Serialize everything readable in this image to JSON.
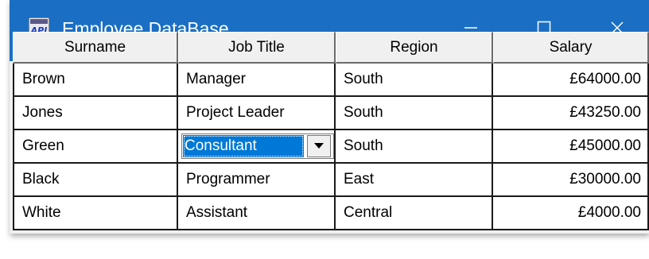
{
  "window": {
    "title": "Employee DataBase",
    "icon": "api-app-icon"
  },
  "title_controls": [
    "minimize-icon",
    "maximize-icon",
    "close-icon"
  ],
  "table": {
    "columns": [
      "Surname",
      "Job Title",
      "Region",
      "Salary"
    ],
    "rows": [
      [
        "Brown",
        "Manager",
        "South",
        "£64000.00"
      ],
      [
        "Jones",
        "Project Leader",
        "South",
        "£43250.00"
      ],
      [
        "Green",
        "Consultant",
        "South",
        "£45000.00"
      ],
      [
        "Black",
        "Programmer",
        "East",
        "£30000.00"
      ],
      [
        "White",
        "Assistant",
        "Central",
        "£4000.00"
      ]
    ],
    "editing": {
      "row": 2,
      "column": 1,
      "value": "Consultant"
    }
  },
  "colors": {
    "titlebar": "#1a6fc4",
    "selection": "#0078d7"
  }
}
